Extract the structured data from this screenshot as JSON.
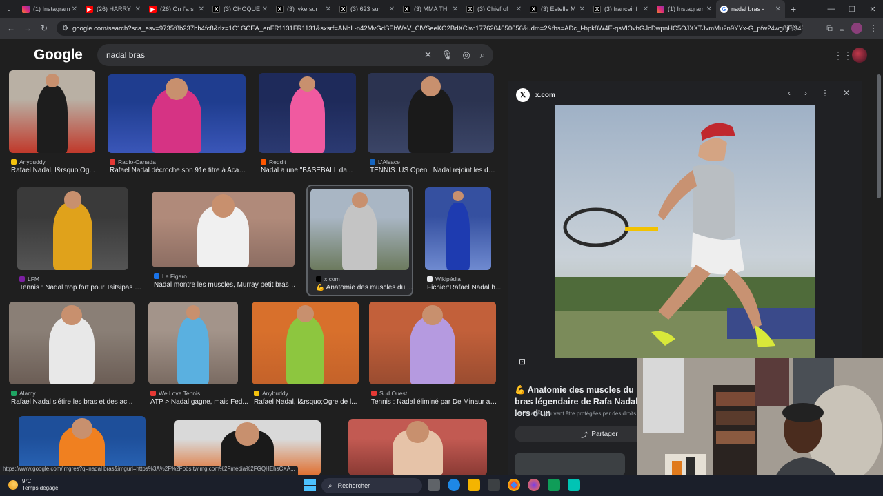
{
  "tabs": [
    {
      "label": "(1) Instagram",
      "icon": "instagram-icon",
      "fav": "insta"
    },
    {
      "label": "(26) HARRY",
      "icon": "youtube-icon",
      "fav": "yt"
    },
    {
      "label": "(26) On l'a s",
      "icon": "youtube-icon",
      "fav": "yt"
    },
    {
      "label": "(3) CHOQUE",
      "icon": "x-icon",
      "fav": "x"
    },
    {
      "label": "(3) lyke sur",
      "icon": "x-icon",
      "fav": "x"
    },
    {
      "label": "(3) 623 sur",
      "icon": "x-icon",
      "fav": "x"
    },
    {
      "label": "(3) MMA TH",
      "icon": "x-icon",
      "fav": "x"
    },
    {
      "label": "(3) Chief of",
      "icon": "x-icon",
      "fav": "x"
    },
    {
      "label": "(3) Estelle M",
      "icon": "x-icon",
      "fav": "x"
    },
    {
      "label": "(3) franceinf",
      "icon": "x-icon",
      "fav": "x"
    },
    {
      "label": "(1) Instagram",
      "icon": "instagram-icon",
      "fav": "insta"
    },
    {
      "label": "nadal bras -",
      "icon": "google-icon",
      "fav": "g",
      "active": true
    }
  ],
  "address": {
    "url": "google.com/search?sca_esv=9735f8b237bb4fc8&rlz=1C1GCEA_enFR1131FR1131&sxsrf=ANbL-n42MvGdSEhWeV_ClVSeeKO2BdXCiw:1776204650656&udm=2&fbs=ADc_l-bpk8W4E-qsVlOvbGJcDwpnHC5OJXXTJvmMu2n9YYx-G_pfw24wg8jEi34E91x..."
  },
  "google": {
    "logo": "Google",
    "query": "nadal bras"
  },
  "results": [
    {
      "source": "Anybuddy",
      "caption": "Rafael Nadal, l&rsquo;Og...",
      "src_color": "#f4c20d",
      "colors": [
        "#b9b0a4",
        "#1d1d1d",
        "#c0392b"
      ]
    },
    {
      "source": "Radio-Canada",
      "caption": "Rafael Nadal décroche son 91e titre à Acapul...",
      "src_color": "#e53935",
      "colors": [
        "#1f3d8f",
        "#d63384",
        "#3a56b8"
      ]
    },
    {
      "source": "Reddit",
      "caption": "Nadal a une \"BASEBALL da...",
      "src_color": "#ff5700",
      "colors": [
        "#1e2a5a",
        "#f05aa0",
        "#2b3a72"
      ]
    },
    {
      "source": "L'Alsace",
      "caption": "TENNIS. US Open : Nadal rejoint les de...",
      "src_color": "#1565c0",
      "colors": [
        "#2b3350",
        "#1a1a1a",
        "#3b4567"
      ]
    },
    {
      "source": "LFM",
      "caption": "Tennis : Nadal trop fort pour Tsitsipas | ...",
      "src_color": "#7b1fa2",
      "colors": [
        "#3a3a3a",
        "#e0a21b",
        "#555"
      ]
    },
    {
      "source": "Le Figaro",
      "caption": "Nadal montre les muscles, Murray petit bras : ce ...",
      "src_color": "#1a73e8",
      "colors": [
        "#b08a7a",
        "#f0f0f0",
        "#8c6d62"
      ]
    },
    {
      "source": "x.com",
      "caption": "💪 Anatomie des muscles du ...",
      "src_color": "#000000",
      "colors": [
        "#a9b6c4",
        "#c4c4c4",
        "#6c7a5e"
      ]
    },
    {
      "source": "Wikipédia",
      "caption": "Fichier:Rafael Nadal h...",
      "src_color": "#e8eaed",
      "colors": [
        "#3550a0",
        "#1e3bb0",
        "#6f8ad0"
      ]
    },
    {
      "source": "Alamy",
      "caption": "Rafael Nadal s'étire les bras et des ac...",
      "src_color": "#1fa463",
      "colors": [
        "#8a7f76",
        "#e8e8e8",
        "#6b5d55"
      ]
    },
    {
      "source": "We Love Tennis",
      "caption": "ATP > Nadal gagne, mais Fed...",
      "src_color": "#e53935",
      "colors": [
        "#a3948a",
        "#5ab0e0",
        "#7a6b62"
      ]
    },
    {
      "source": "Anybuddy",
      "caption": "Rafael Nadal, l&rsquo;Ogre de l...",
      "src_color": "#f4c20d",
      "colors": [
        "#d8702c",
        "#8dc63f",
        "#c4622a"
      ]
    },
    {
      "source": "Sud Ouest",
      "caption": "Tennis : Nadal éliminé par De Minaur au...",
      "src_color": "#e53935",
      "colors": [
        "#c2603a",
        "#b59ae0",
        "#9a4c30"
      ]
    },
    {
      "source": "",
      "caption": "",
      "src_color": "#000000",
      "colors": [
        "#1e4f9a",
        "#f08020",
        "#2a66b8"
      ]
    },
    {
      "source": "",
      "caption": "",
      "src_color": "#000000",
      "colors": [
        "#d9d9d9",
        "#1a1a1a",
        "#e07030"
      ]
    },
    {
      "source": "",
      "caption": "",
      "src_color": "#000000",
      "colors": [
        "#c25a52",
        "#e6c3a8",
        "#8a3a34"
      ]
    }
  ],
  "panel": {
    "site": "x.com",
    "title": "💪 Anatomie des muscles du bras légendaire de Rafa Nadal lors d'un",
    "note": "Les images peuvent être protégées par des droits",
    "share_label": "Partager"
  },
  "statusbar": {
    "url": "https://www.google.com/imgres?q=nadal bras&imgurl=https%3A%2F%2Fpbs.twimg.com%2Fmedia%2FGQHEhsCXA..."
  },
  "taskbar": {
    "temp": "9°C",
    "weather": "Temps dégagé",
    "search": "Rechercher"
  }
}
